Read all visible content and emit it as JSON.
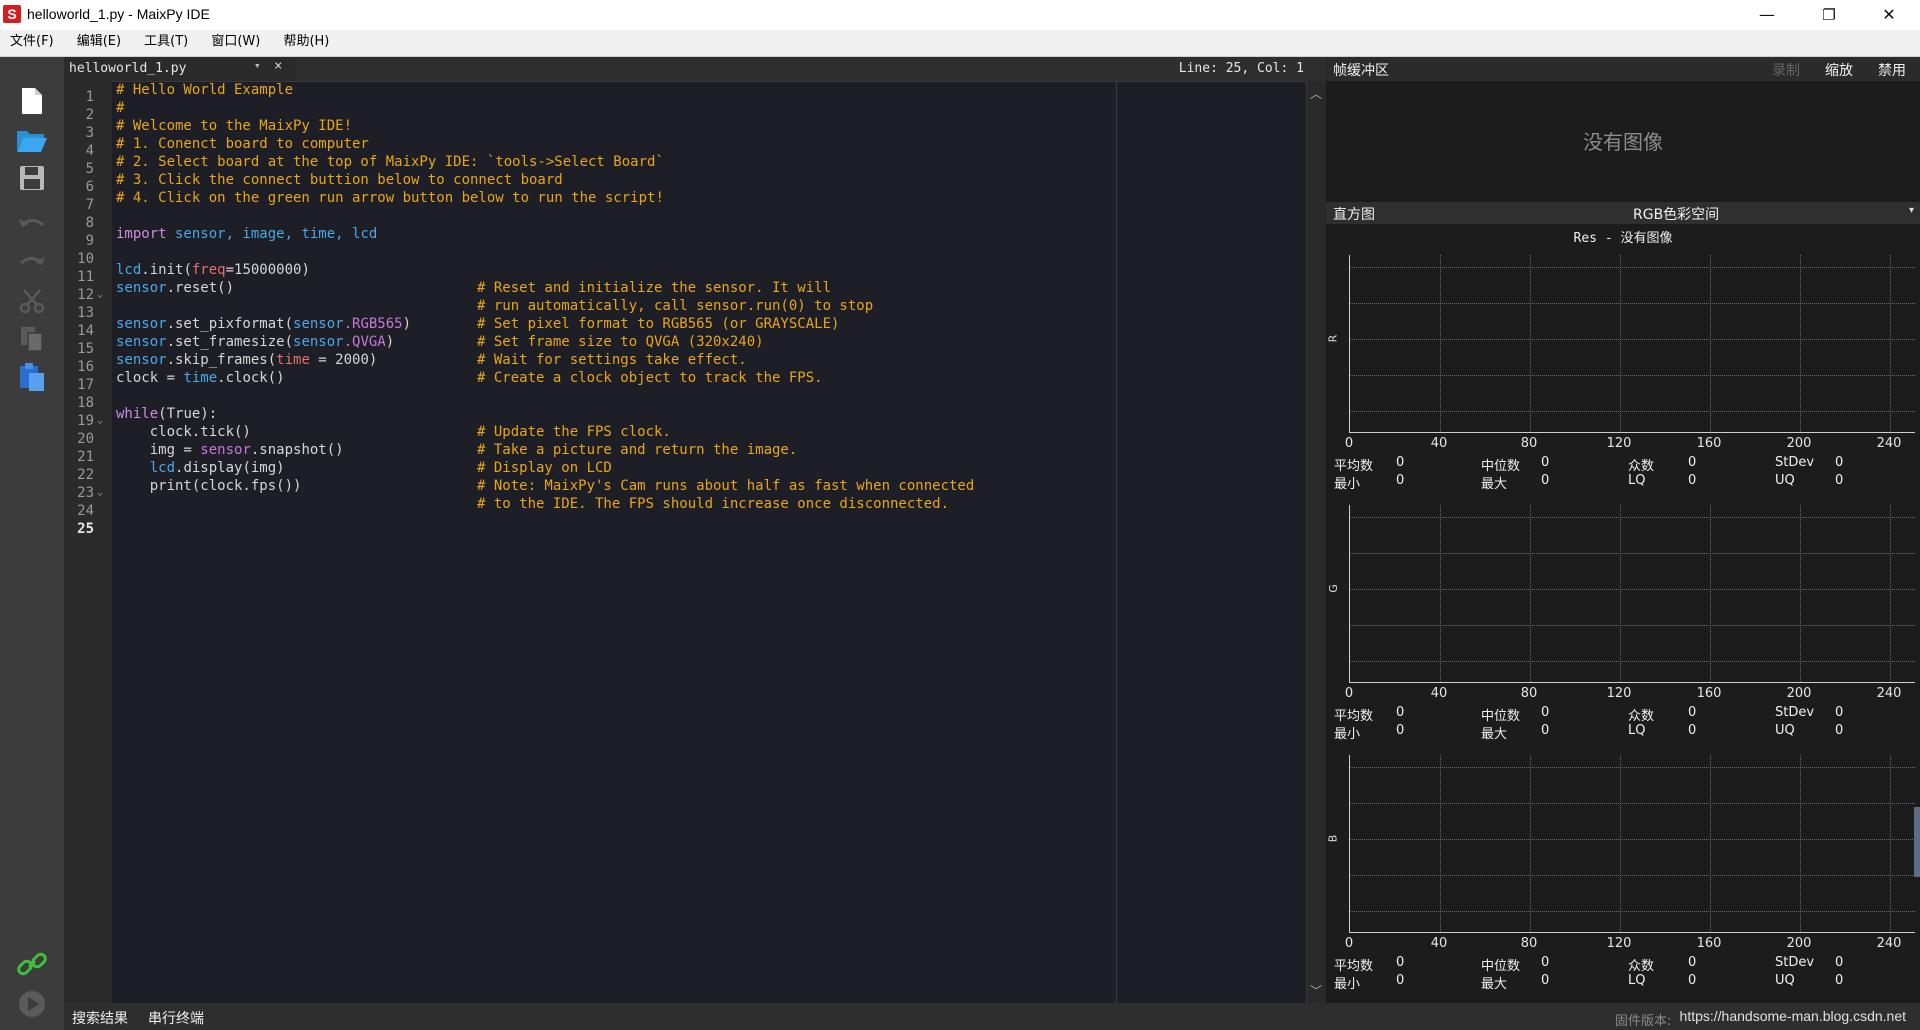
{
  "window": {
    "title": "helloworld_1.py - MaixPy IDE",
    "logo_letter": "S",
    "minimize": "—",
    "maximize": "❐",
    "close": "✕"
  },
  "menu": [
    "文件(F)",
    "编辑(E)",
    "工具(T)",
    "窗口(W)",
    "帮助(H)"
  ],
  "editor": {
    "tab_label": "helloworld_1.py",
    "tab_dropdown": "▾",
    "tab_close": "×",
    "cursor_position": "Line: 25, Col: 1",
    "line_numbers": [
      "1",
      "2",
      "3",
      "4",
      "5",
      "6",
      "7",
      "8",
      "9",
      "10",
      "11",
      "12",
      "13",
      "14",
      "15",
      "16",
      "17",
      "18",
      "19",
      "20",
      "21",
      "22",
      "23",
      "24",
      "25"
    ],
    "fold_markers": [
      "12",
      "19",
      "23"
    ]
  },
  "code": {
    "l1": "# Hello World Example",
    "l2": "#",
    "l3": "# Welcome to the MaixPy IDE!",
    "l4": "# 1. Conenct board to computer",
    "l5": "# 2. Select board at the top of MaixPy IDE: `tools->Select Board`",
    "l6": "# 3. Click the connect buttion below to connect board",
    "l7": "# 4. Click on the green run arrow button below to run the script!",
    "l9_kw": "import",
    "l9_rest": " sensor, image, time, lcd",
    "l11_a": "lcd",
    "l11_b": ".init(",
    "l11_c": "freq",
    "l11_d": "=15000000)",
    "l12_a": "sensor",
    "l12_b": ".reset()",
    "l12_c": "# Reset and initialize the sensor. It will",
    "l13_c": "# run automatically, call sensor.run(0) to stop",
    "l14_a": "sensor",
    "l14_b": ".set_pixformat(",
    "l14_c": "sensor",
    "l14_d": ".RGB565",
    "l14_e": ")",
    "l14_f": "# Set pixel format to RGB565 (or GRAYSCALE)",
    "l15_a": "sensor",
    "l15_b": ".set_framesize(",
    "l15_c": "sensor",
    "l15_d": ".QVGA",
    "l15_e": ")",
    "l15_f": "# Set frame size to QVGA (320x240)",
    "l16_a": "sensor",
    "l16_b": ".skip_frames(",
    "l16_c": "time",
    "l16_d": " = 2000)",
    "l16_f": "# Wait for settings take effect.",
    "l17_a": "clock = ",
    "l17_b": "time",
    "l17_c": ".clock()",
    "l17_f": "# Create a clock object to track the FPS.",
    "l19_kw": "while",
    "l19_rest": "(True):",
    "l20_a": "    clock.tick()",
    "l20_f": "# Update the FPS clock.",
    "l21_a": "    img = ",
    "l21_b": "sensor",
    "l21_c": ".snapshot()",
    "l21_f": "# Take a picture and return the image.",
    "l22_a": "    ",
    "l22_b": "lcd",
    "l22_c": ".display(img)",
    "l22_f": "# Display on LCD",
    "l23_a": "    print(clock.fps())",
    "l23_f": "# Note: MaixPy's Cam runs about half as fast when connected",
    "l24_f": "# to the IDE. The FPS should increase once disconnected."
  },
  "framebuffer": {
    "title": "帧缓冲区",
    "record": "录制",
    "zoom": "缩放",
    "disable": "禁用",
    "no_image": "没有图像"
  },
  "histogram": {
    "title": "直方图",
    "color_space": "RGB色彩空间",
    "color_space_arrow": "▾",
    "res_label": "Res - 没有图像",
    "ticks": [
      "0",
      "40",
      "80",
      "120",
      "160",
      "200",
      "240"
    ],
    "channels": [
      {
        "name": "R",
        "mean": "0",
        "median": "0",
        "mode": "0",
        "stdev": "0",
        "min": "0",
        "max": "0",
        "lq": "0",
        "uq": "0"
      },
      {
        "name": "G",
        "mean": "0",
        "median": "0",
        "mode": "0",
        "stdev": "0",
        "min": "0",
        "max": "0",
        "lq": "0",
        "uq": "0"
      },
      {
        "name": "B",
        "mean": "0",
        "median": "0",
        "mode": "0",
        "stdev": "0",
        "min": "0",
        "max": "0",
        "lq": "0",
        "uq": "0"
      }
    ],
    "labels": {
      "mean": "平均数",
      "median": "中位数",
      "mode": "众数",
      "stdev": "StDev",
      "min": "最小",
      "max": "最大",
      "lq": "LQ",
      "uq": "UQ"
    }
  },
  "bottom": {
    "search_results": "搜索结果",
    "serial_terminal": "串行终端",
    "firmware": "固件版本:",
    "watermark": "https://handsome-man.blog.csdn.net"
  },
  "icons": [
    "new-file-icon",
    "open-folder-icon",
    "save-icon",
    "undo-icon",
    "redo-icon",
    "cut-icon",
    "copy-icon",
    "paste-icon",
    "connect-icon",
    "run-icon"
  ]
}
